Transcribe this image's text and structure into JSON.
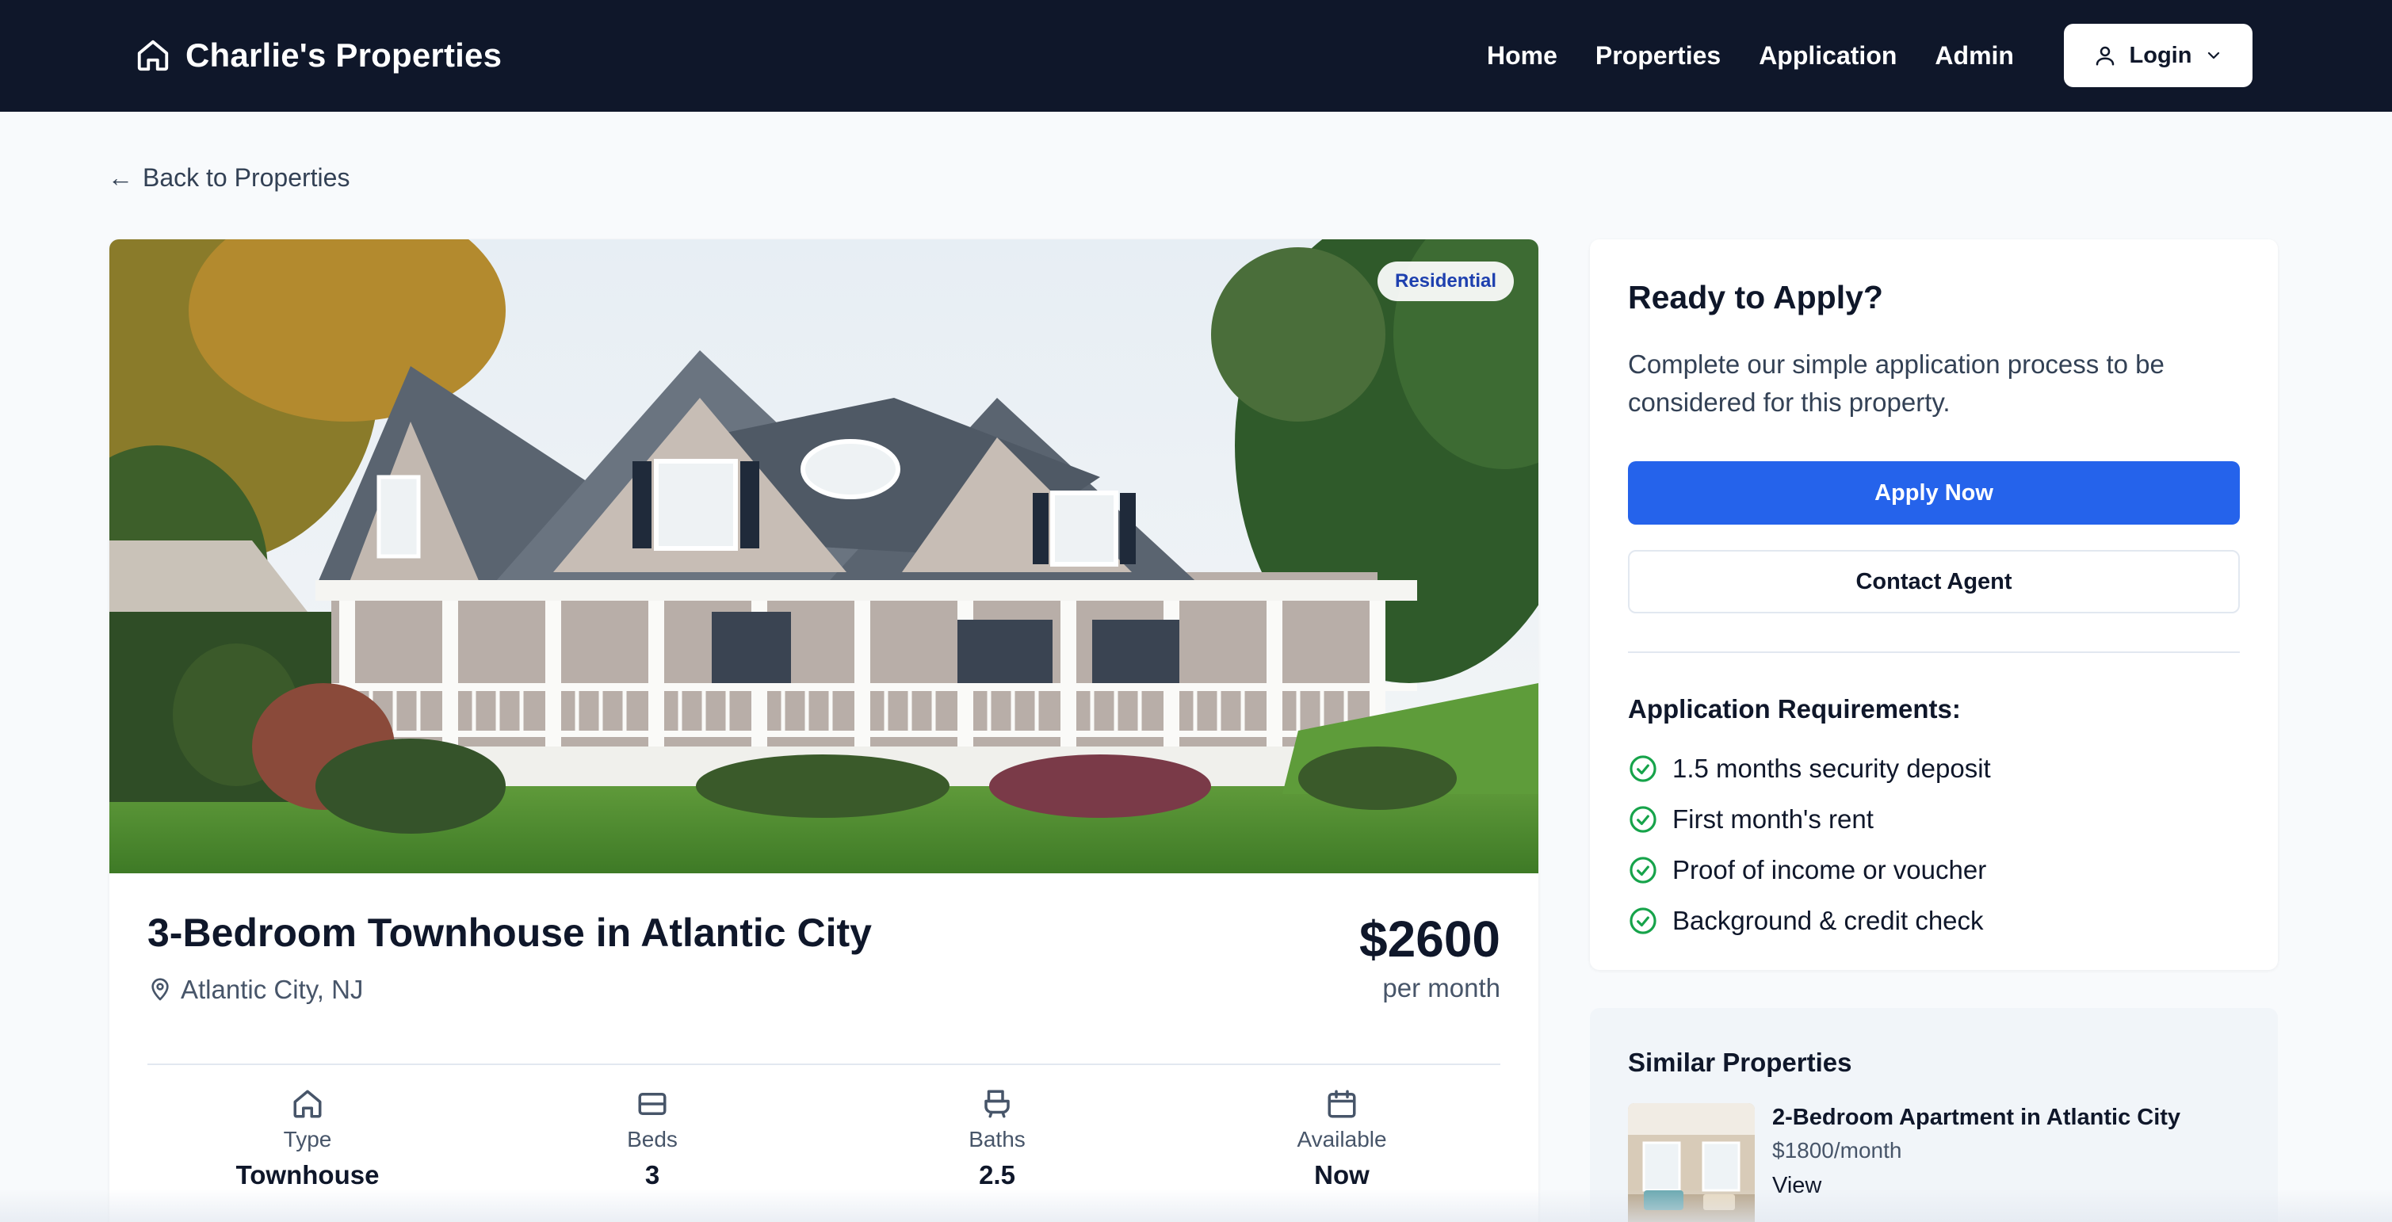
{
  "nav": {
    "brand": "Charlie's Properties",
    "links": [
      "Home",
      "Properties",
      "Application",
      "Admin"
    ],
    "login_label": "Login"
  },
  "back_link": "Back to Properties",
  "property": {
    "badge": "Residential",
    "title": "3-Bedroom Townhouse in Atlantic City",
    "location": "Atlantic City, NJ",
    "price": "$2600",
    "price_period": "per month",
    "stats": [
      {
        "label": "Type",
        "value": "Townhouse",
        "icon": "home-icon"
      },
      {
        "label": "Beds",
        "value": "3",
        "icon": "bed-icon"
      },
      {
        "label": "Baths",
        "value": "2.5",
        "icon": "bath-icon"
      },
      {
        "label": "Available",
        "value": "Now",
        "icon": "calendar-icon"
      }
    ]
  },
  "apply": {
    "title": "Ready to Apply?",
    "description": "Complete our simple application process to be considered for this property.",
    "apply_button": "Apply Now",
    "contact_button": "Contact Agent",
    "requirements_title": "Application Requirements:",
    "requirements": [
      "1.5 months security deposit",
      "First month's rent",
      "Proof of income or voucher",
      "Background & credit check"
    ]
  },
  "similar": {
    "title": "Similar Properties",
    "items": [
      {
        "name": "2-Bedroom Apartment in Atlantic City",
        "price": "$1800/month",
        "link": "View"
      }
    ]
  },
  "colors": {
    "nav_bg": "#0f172a",
    "primary": "#2563eb",
    "check": "#16a34a",
    "badge_text": "#1e40af"
  }
}
